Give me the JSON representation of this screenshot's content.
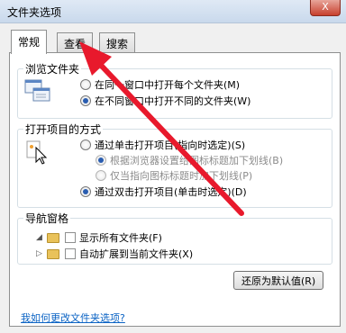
{
  "window": {
    "title": "文件夹选项",
    "close_label": "X"
  },
  "tabs": [
    {
      "label": "常规",
      "active": true
    },
    {
      "label": "查看",
      "active": false
    },
    {
      "label": "搜索",
      "active": false
    }
  ],
  "browse_group": {
    "legend": "浏览文件夹",
    "options": [
      {
        "label": "在同一窗口中打开每个文件夹(M)",
        "checked": false
      },
      {
        "label": "在不同窗口中打开不同的文件夹(W)",
        "checked": true
      }
    ]
  },
  "open_group": {
    "legend": "打开项目的方式",
    "options": [
      {
        "label": "通过单击打开项目(指向时选定)(S)",
        "checked": false
      },
      {
        "label": "根据浏览器设置给图标标题加下划线(B)",
        "checked": true,
        "disabled": true
      },
      {
        "label": "仅当指向图标标题时加下划线(P)",
        "checked": false,
        "disabled": true
      },
      {
        "label": "通过双击打开项目(单击时选定)(D)",
        "checked": true
      }
    ]
  },
  "nav_group": {
    "legend": "导航窗格",
    "options": [
      {
        "label": "显示所有文件夹(F)",
        "checked": false
      },
      {
        "label": "自动扩展到当前文件夹(X)",
        "checked": false
      }
    ]
  },
  "restore_button": "还原为默认值(R)",
  "help_link": "我如何更改文件夹选项?",
  "annotation": {
    "color": "#e8192c"
  }
}
